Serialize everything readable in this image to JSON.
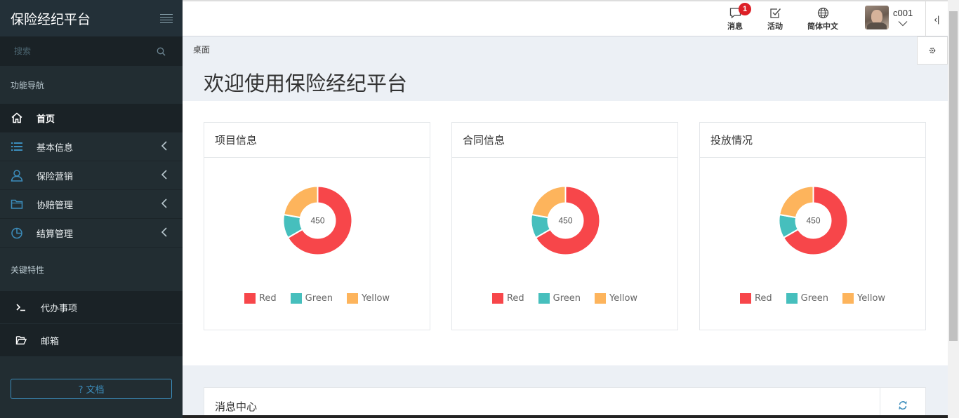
{
  "app": {
    "title": "保险经纪平台"
  },
  "sidebar": {
    "search_placeholder": "搜索",
    "nav_section": "功能导航",
    "items": [
      {
        "label": "首页",
        "icon": "home-icon",
        "active": true
      },
      {
        "label": "基本信息",
        "icon": "list-icon"
      },
      {
        "label": "保险营销",
        "icon": "user-icon"
      },
      {
        "label": "协赔管理",
        "icon": "folder-icon"
      },
      {
        "label": "结算管理",
        "icon": "pie-icon"
      }
    ],
    "features_section": "关键特性",
    "features": [
      {
        "label": "代办事项",
        "icon": "terminal-icon"
      },
      {
        "label": "邮箱",
        "icon": "folder-open-icon"
      }
    ],
    "doc_button": "? 文档"
  },
  "header": {
    "messages_label": "消息",
    "messages_badge": "1",
    "activity_label": "活动",
    "language_label": "简体中文",
    "username": "c001",
    "collapse_glyph": "‹|"
  },
  "breadcrumb": "桌面",
  "welcome_title": "欢迎使用保险经纪平台",
  "colors": {
    "red": "#f7464a",
    "green": "#46bfbd",
    "yellow": "#fdb45c",
    "sidebar": "#222d32",
    "accent": "#3c8dbc"
  },
  "chart_data": [
    {
      "type": "pie",
      "title": "项目信息",
      "center_label": "450",
      "categories": [
        "Red",
        "Green",
        "Yellow"
      ],
      "values": [
        300,
        50,
        100
      ]
    },
    {
      "type": "pie",
      "title": "合同信息",
      "center_label": "450",
      "categories": [
        "Red",
        "Green",
        "Yellow"
      ],
      "values": [
        300,
        50,
        100
      ]
    },
    {
      "type": "pie",
      "title": "投放情况",
      "center_label": "450",
      "categories": [
        "Red",
        "Green",
        "Yellow"
      ],
      "values": [
        300,
        50,
        100
      ]
    }
  ],
  "message_center": {
    "title": "消息中心"
  }
}
